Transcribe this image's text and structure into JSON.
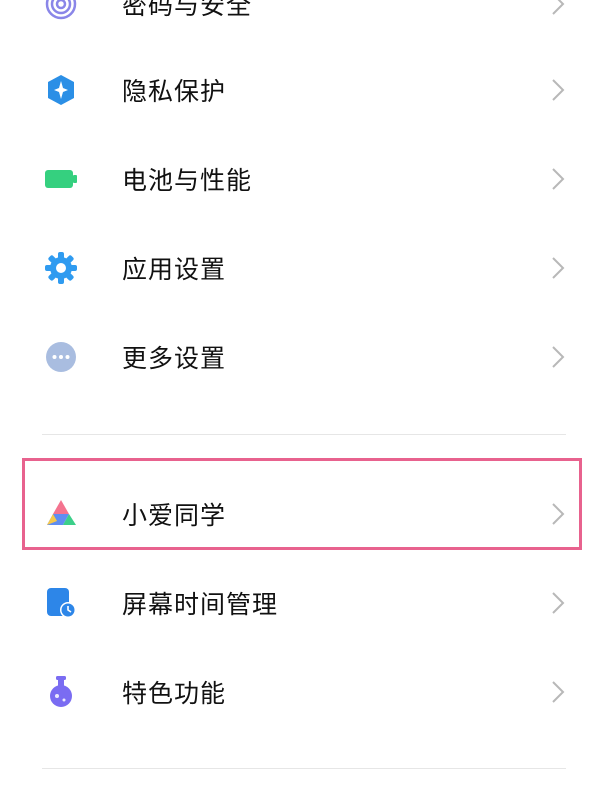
{
  "settings": {
    "items": [
      {
        "label": "密码与安全",
        "icon": "fingerprint-icon"
      },
      {
        "label": "隐私保护",
        "icon": "privacy-shield-icon"
      },
      {
        "label": "电池与性能",
        "icon": "battery-icon"
      },
      {
        "label": "应用设置",
        "icon": "gear-icon"
      },
      {
        "label": "更多设置",
        "icon": "more-dots-icon"
      }
    ],
    "items2": [
      {
        "label": "小爱同学",
        "icon": "xiaoai-assistant-icon"
      },
      {
        "label": "屏幕时间管理",
        "icon": "screen-time-icon"
      },
      {
        "label": "特色功能",
        "icon": "flask-icon"
      }
    ]
  },
  "colors": {
    "highlight": "#e8628e",
    "privacy_blue": "#2b8fe6",
    "battery_green": "#35d07f",
    "gear_blue": "#2f9bf0",
    "more_grey": "#a9bde0",
    "screen_time_blue": "#2d86e8",
    "flask_purple": "#7a6cf2"
  }
}
